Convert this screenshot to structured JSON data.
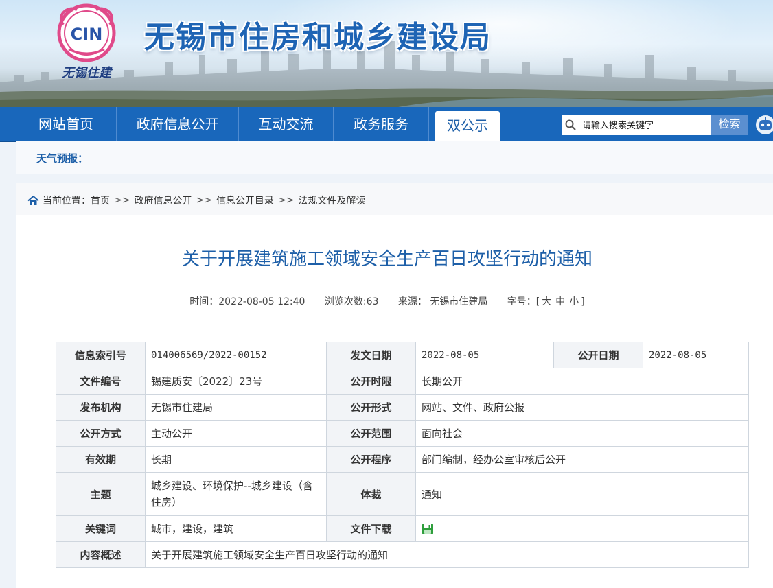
{
  "header": {
    "site_title": "无锡市住房和城乡建设局",
    "logo_text": "CIN",
    "logo_city": "无锡住建"
  },
  "nav": {
    "items": [
      {
        "label": "网站首页"
      },
      {
        "label": "政府信息公开"
      },
      {
        "label": "互动交流"
      },
      {
        "label": "政务服务"
      },
      {
        "label": "双公示"
      }
    ],
    "search_placeholder": "请输入搜索关键字",
    "search_button": "检索"
  },
  "weather": {
    "label": "天气预报："
  },
  "breadcrumb": {
    "prefix": "当前位置：",
    "sep": ">>",
    "items": [
      "首页",
      "政府信息公开",
      "信息公开目录",
      "法规文件及解读"
    ]
  },
  "article": {
    "title": "关于开展建筑施工领域安全生产百日攻坚行动的通知",
    "time": "时间：2022-08-05 12:40",
    "views": "浏览次数:63",
    "source": "来源： 无锡市住建局",
    "font_size_label": "字号：[",
    "font_large": "大",
    "font_medium": "中",
    "font_small": "小",
    "font_size_close": "]"
  },
  "info_table": {
    "index_label": "信息索引号",
    "index_value": "014006569/2022-00152",
    "issue_date_label": "发文日期",
    "issue_date_value": "2022-08-05",
    "public_date_label": "公开日期",
    "public_date_value": "2022-08-05",
    "doc_no_label": "文件编号",
    "doc_no_value": "锡建质安〔2022〕23号",
    "period_label": "公开时限",
    "period_value": "长期公开",
    "publisher_label": "发布机构",
    "publisher_value": "无锡市住建局",
    "form_label": "公开形式",
    "form_value": "网站、文件、政府公报",
    "method_label": "公开方式",
    "method_value": "主动公开",
    "scope_label": "公开范围",
    "scope_value": "面向社会",
    "validity_label": "有效期",
    "validity_value": "长期",
    "procedure_label": "公开程序",
    "procedure_value": "部门编制，经办公室审核后公开",
    "topic_label": "主题",
    "topic_value": "城乡建设、环境保护--城乡建设（含住房）",
    "genre_label": "体裁",
    "genre_value": "通知",
    "keywords_label": "关键词",
    "keywords_value": "城市，建设，建筑",
    "download_label": "文件下载",
    "summary_label": "内容概述",
    "summary_value": "关于开展建筑施工领域安全生产百日攻坚行动的通知"
  },
  "colors": {
    "brand": "#1967bb",
    "title": "#1d5fa8"
  },
  "icons": [
    "home-icon",
    "search-icon",
    "robot-icon",
    "save-icon"
  ]
}
